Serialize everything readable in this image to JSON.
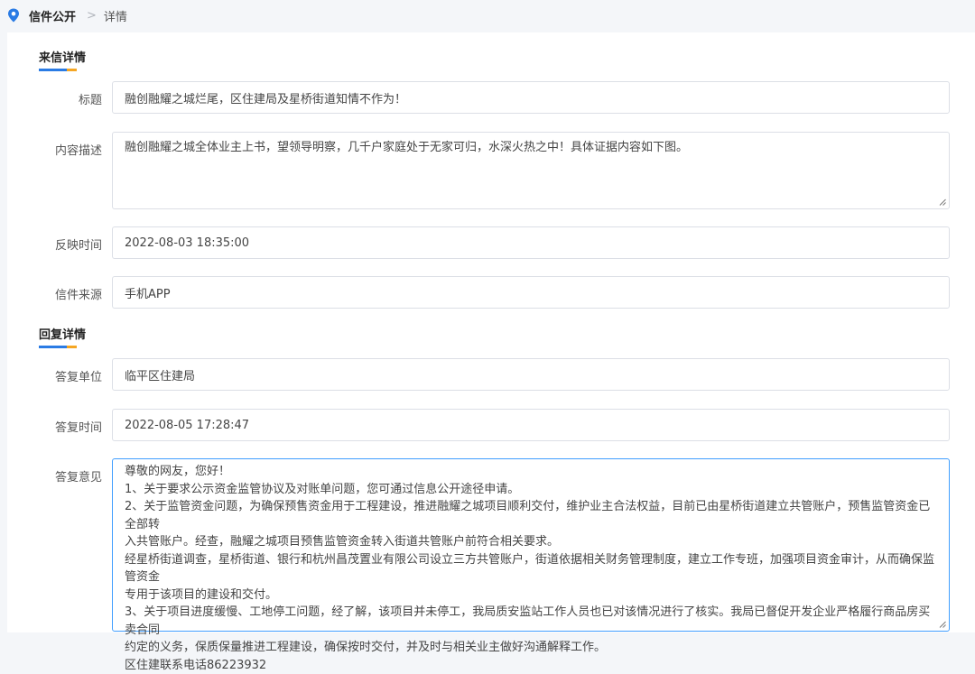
{
  "breadcrumb": {
    "home": "信件公开",
    "separator": ">",
    "current": "详情"
  },
  "letter_section": {
    "title": "来信详情",
    "title_label": "标题",
    "title_value": "融创融耀之城烂尾，区住建局及星桥街道知情不作为！",
    "content_label": "内容描述",
    "content_value": "融创融耀之城全体业主上书，望领导明察，几千户家庭处于无家可归，水深火热之中！具体证据内容如下图。",
    "time_label": "反映时间",
    "time_value": "2022-08-03 18:35:00",
    "source_label": "信件来源",
    "source_value": "手机APP"
  },
  "reply_section": {
    "title": "回复详情",
    "unit_label": "答复单位",
    "unit_value": "临平区住建局",
    "time_label": "答复时间",
    "time_value": "2022-08-05 17:28:47",
    "opinion_label": "答复意见",
    "opinion_lines": [
      "尊敬的网友，您好！",
      "1、关于要求公示资金监管协议及对账单问题，您可通过信息公开途径申请。",
      "2、关于监管资金问题，为确保预售资金用于工程建设，推进融耀之城项目顺利交付，维护业主合法权益，目前已由星桥街道建立共管账户，预售监管资金已全部转",
      "入共管账户。经查，融耀之城项目预售监管资金转入街道共管账户前符合相关要求。",
      "经星桥街道调查，星桥街道、银行和杭州昌茂置业有限公司设立三方共管账户，街道依据相关财务管理制度，建立工作专班，加强项目资金审计，从而确保监管资金",
      "专用于该项目的建设和交付。",
      "3、关于项目进度缓慢、工地停工问题，经了解，该项目并未停工，我局质安监站工作人员也已对该情况进行了核实。我局已督促开发企业严格履行商品房买卖合同",
      "约定的义务，保质保量推进工程建设，确保按时交付，并及时与相关业主做好沟通解释工作。",
      "区住建联系电话86223932"
    ]
  },
  "colors": {
    "accent_blue": "#2a7be4",
    "accent_orange": "#f5a623",
    "focus_border": "#409eff"
  }
}
